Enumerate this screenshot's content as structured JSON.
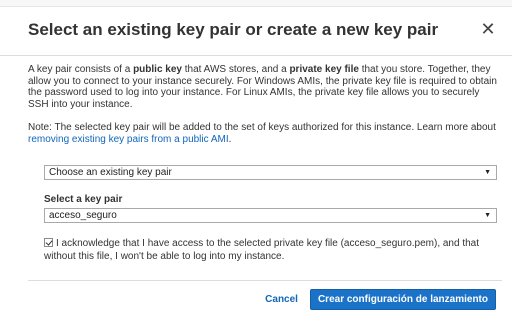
{
  "dialog": {
    "title": "Select an existing key pair or create a new key pair",
    "close_symbol": "✕"
  },
  "description": {
    "text_1": "A key pair consists of a ",
    "bold_1": "public key",
    "text_2": " that AWS stores, and a ",
    "bold_2": "private key file",
    "text_3": " that you store. Together, they allow you to connect to your instance securely. For Windows AMIs, the private key file is required to obtain the password used to log into your instance. For Linux AMIs, the private key file allows you to securely SSH into your instance."
  },
  "note": {
    "text": "Note: The selected key pair will be added to the set of keys authorized for this instance. Learn more about ",
    "link": "removing existing key pairs from a public AMI",
    "suffix": "."
  },
  "key_pair_option": {
    "selected": "Choose an existing key pair"
  },
  "key_pair_select": {
    "label": "Select a key pair",
    "selected": "acceso_seguro"
  },
  "acknowledge": {
    "checked": true,
    "text": "I acknowledge that I have access to the selected private key file (acceso_seguro.pem), and that without this file, I won't be able to log into my instance."
  },
  "footer": {
    "cancel_label": "Cancel",
    "primary_label": "Crear configuración de lanzamiento"
  },
  "colors": {
    "primary_button": "#1a73c8",
    "link": "#1166bb",
    "text": "#333333"
  },
  "icons": {
    "close": "close-icon",
    "dropdown": "chevron-down-icon",
    "checkbox": "checkbox-checked-icon"
  }
}
